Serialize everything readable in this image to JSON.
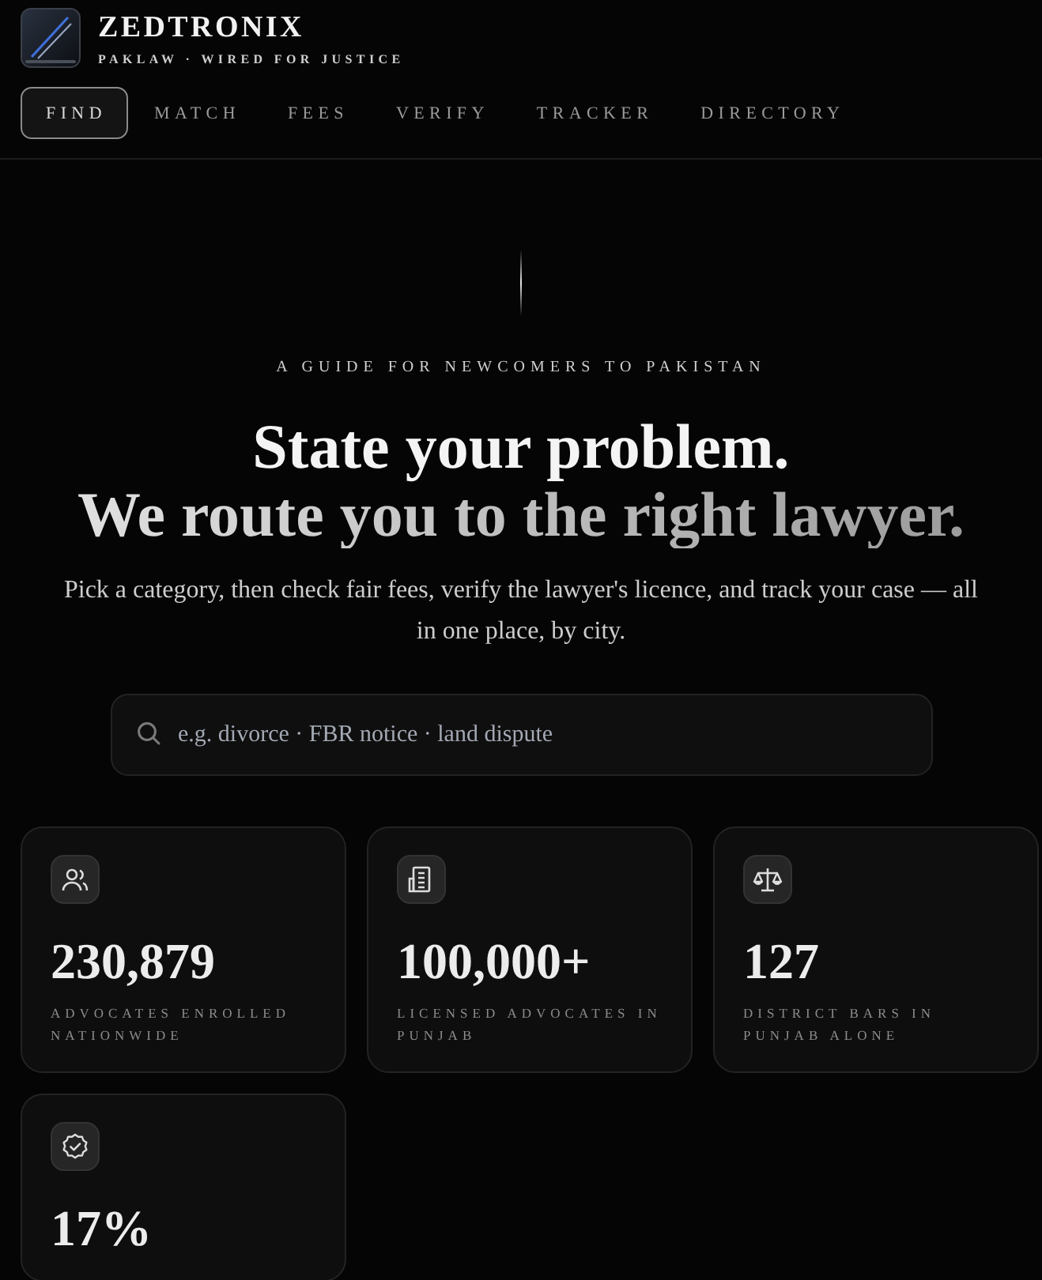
{
  "brand": {
    "name": "ZEDTRONIX",
    "tagline": "PAKLAW · WIRED FOR JUSTICE"
  },
  "nav": [
    {
      "label": "FIND",
      "selected": true
    },
    {
      "label": "MATCH",
      "selected": false
    },
    {
      "label": "FEES",
      "selected": false
    },
    {
      "label": "VERIFY",
      "selected": false
    },
    {
      "label": "TRACKER",
      "selected": false
    },
    {
      "label": "DIRECTORY",
      "selected": false
    }
  ],
  "hero": {
    "eyebrow": "A GUIDE FOR NEWCOMERS TO PAKISTAN",
    "headline": "State your problem.",
    "headline_accent": "We route you to the right lawyer.",
    "intro": "Pick a category, then check fair fees, verify the lawyer's licence, and track your case — all in one place, by city."
  },
  "search": {
    "placeholder": "e.g. divorce · FBR notice · land dispute"
  },
  "stats": [
    {
      "value": "230,879",
      "label": "ADVOCATES ENROLLED NATIONWIDE"
    },
    {
      "value": "100,000+",
      "label": "LICENSED ADVOCATES IN PUNJAB"
    },
    {
      "value": "127",
      "label": "DISTRICT BARS IN PUNJAB ALONE"
    },
    {
      "value": "17%"
    }
  ]
}
